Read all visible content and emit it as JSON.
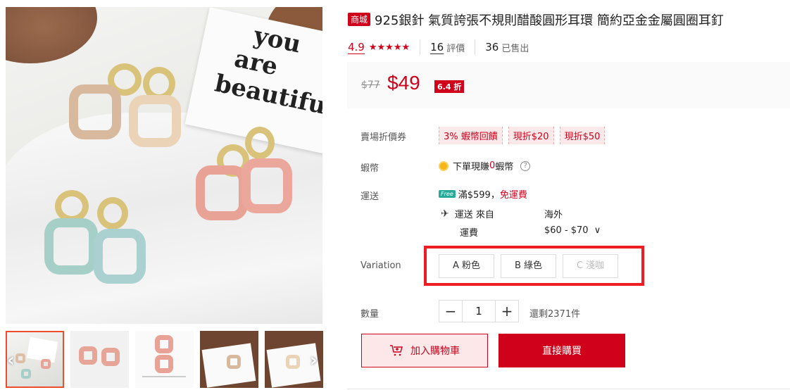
{
  "product": {
    "mall_badge": "商城",
    "title": "925銀針 氣質誇張不規則醋酸圓形耳環 簡約亞金金屬圓圈耳釘"
  },
  "rating": {
    "score": "4.9",
    "stars": "★★★★★",
    "reviews_count": "16",
    "reviews_label": "評價",
    "sold_count": "36",
    "sold_label": "已售出"
  },
  "price": {
    "original": "$77",
    "current": "$49",
    "discount": "6.4 折"
  },
  "vouchers": {
    "label": "賣場折價券",
    "items": [
      "3% 蝦幣回饋",
      "現折$20",
      "現折$50"
    ]
  },
  "coins": {
    "label": "蝦幣",
    "text_before": "下單現賺",
    "amount": "0",
    "text_after": "蝦幣",
    "help": "?"
  },
  "shipping": {
    "label": "運送",
    "free_tag": "Free",
    "free_threshold": "滿$599，",
    "free_text": "免運費",
    "from_label": "運送 來自",
    "from_value": "海外",
    "fee_label": "運費",
    "fee_value": "$60 - $70",
    "fee_chevron": "∨"
  },
  "variation": {
    "label": "Variation",
    "options": [
      "A 粉色",
      "B 綠色",
      "C 淺咖"
    ],
    "disabled_index": 2
  },
  "quantity": {
    "label": "數量",
    "minus": "−",
    "value": "1",
    "plus": "+",
    "stock_text": "還剩2371件"
  },
  "actions": {
    "add_to_cart": "加入購物車",
    "buy_now": "直接購買"
  },
  "gallery": {
    "card_words": [
      "you",
      "are",
      "beautiful"
    ],
    "prev_arrow": "‹",
    "next_arrow": "›"
  },
  "colors": {
    "brand_red": "#d0011b",
    "highlight_box": "#ee1d23",
    "active_thumb": "#ee4d2d"
  }
}
